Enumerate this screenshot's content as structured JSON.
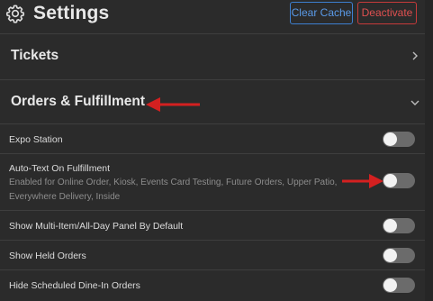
{
  "header": {
    "title": "Settings",
    "gear_icon": "gear-icon",
    "clear_cache_label": "Clear Cache",
    "deactivate_label": "Deactivate",
    "colors": {
      "clear_cache": "#3d7fd0",
      "deactivate": "#c63a3a"
    }
  },
  "sections": {
    "tickets": {
      "title": "Tickets",
      "icon": "chevron-right-icon",
      "expanded": false
    },
    "orders": {
      "title": "Orders & Fulfillment",
      "icon": "chevron-down-icon",
      "expanded": true
    }
  },
  "settings": [
    {
      "label": "Expo Station",
      "description": "",
      "enabled": false
    },
    {
      "label": "Auto-Text On Fulfillment",
      "description": "Enabled for Online Order, Kiosk, Events Card Testing, Future Orders, Upper Patio, Everywhere Delivery, Inside",
      "enabled": false
    },
    {
      "label": "Show Multi-Item/All-Day Panel By Default",
      "description": "",
      "enabled": false
    },
    {
      "label": "Show Held Orders",
      "description": "",
      "enabled": false
    },
    {
      "label": "Hide Scheduled Dine-In Orders",
      "description": "",
      "enabled": false
    }
  ],
  "annotations": {
    "arrow_color": "#d42020"
  }
}
